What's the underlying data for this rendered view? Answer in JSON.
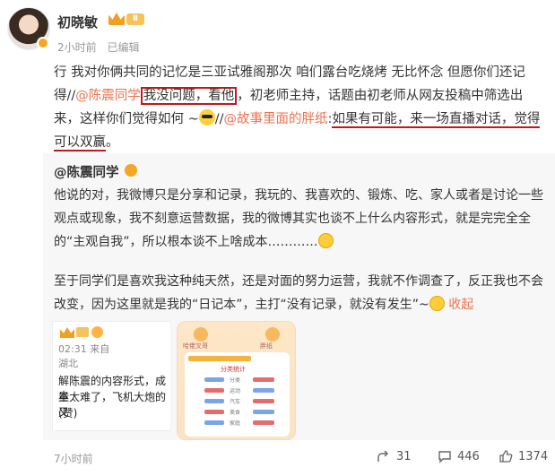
{
  "post": {
    "author": "初晓敏",
    "level": "Ⅱ",
    "time": "2小时前",
    "edited": "已编辑",
    "text": {
      "p1": "行 我对你俩共同的记忆是三亚试雅阁那次 咱们露台吃烧烤 无比怀念 但愿你们还记得//",
      "mention1": "@陈震同学",
      "boxed": "我没问题，看他",
      "p2": "，初老师主持，话题由初老师从网友投稿中筛选出来，这样你们觉得如何 ~",
      "p3": "//",
      "mention2": "@故事里面的胖纸",
      "colon": ":",
      "underlined": "如果有可能，来一场直播对话，觉得可以双赢",
      "end": "。"
    }
  },
  "repost": {
    "author": "@陈震同学",
    "para1": "他说的对，我微博只是分享和记录，我玩的、我喜欢的、锻炼、吃、家人或者是讨论一些观点或现象，我不刻意运营数据，我的微博其实也谈不上什么内容形式，就是完完全全的“主观自我”，所以根本谈不上啥成本…………",
    "para2": "至于同学们是喜欢我这种纯天然，还是对面的努力运营，我就不作调查了，反正我也不会改变，因为这里就是我的“日记本”，主打“没有记录，就没有发生”~",
    "collapse": "收起",
    "thumb1": {
      "time": "02:31",
      "from": "来自",
      "location": "湖北",
      "line1": "解陈震的内容形式，成本",
      "line2": "量太难了，飞机大炮的又",
      "line3": "(赞)"
    },
    "thumb2": {
      "left_name": "哈佬叉哥",
      "right_name": "胖纸",
      "label": "分类统计",
      "rows": [
        "分类",
        "运动",
        "汽车",
        "美食",
        "家庭"
      ]
    }
  },
  "footer": {
    "time": "7小时前",
    "share_count": "31",
    "comment_count": "446",
    "like_count": "1374"
  }
}
